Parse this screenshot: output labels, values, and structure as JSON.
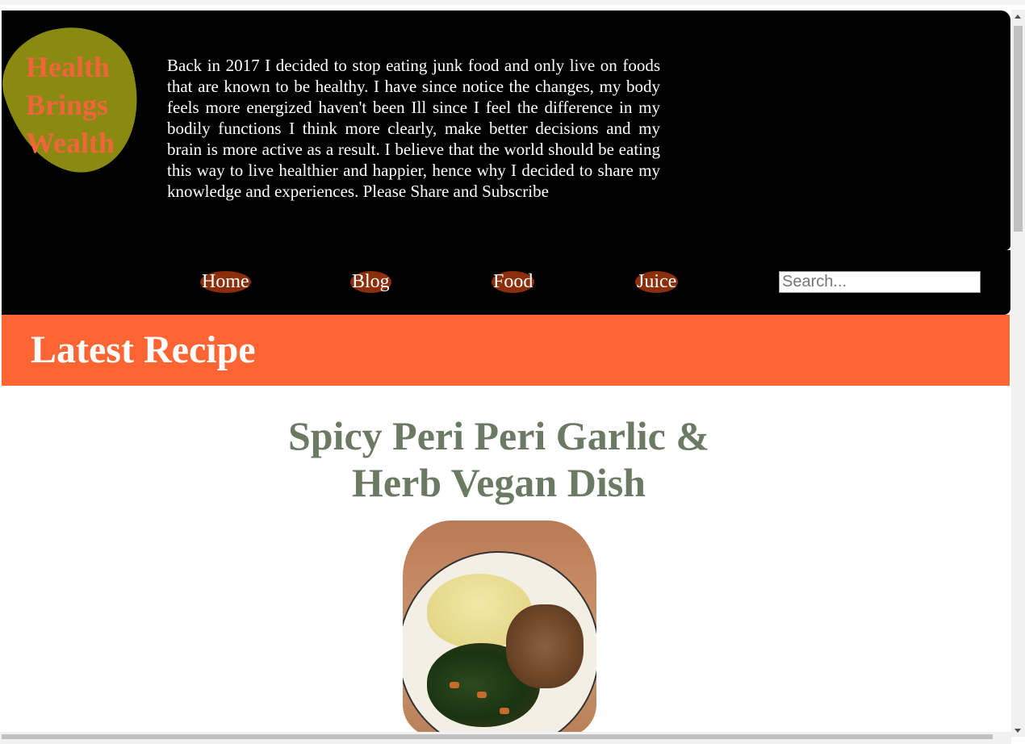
{
  "header": {
    "logo_text": "Health Brings Wealth",
    "intro": "Back in 2017 I decided to stop eating junk food and only live on foods that are known to be healthy. I have since notice the changes, my body feels more energized haven't been Ill since I feel the difference in my bodily functions I think more clearly, make better decisions and my brain is more active as a result. I believe that the world should be eating this way to live healthier and happier, hence why I decided to share my knowledge and experiences. Please Share and Subscribe"
  },
  "nav": {
    "items": [
      {
        "label": "Home"
      },
      {
        "label": "Blog"
      },
      {
        "label": "Food"
      },
      {
        "label": "Juice"
      }
    ],
    "search_placeholder": "Search..."
  },
  "banner": {
    "title": "Latest Recipe"
  },
  "recipe": {
    "title": "Spicy Peri Peri Garlic & Herb Vegan Dish"
  },
  "colors": {
    "header_bg": "#000000",
    "logo_bg": "#8a8a12",
    "logo_text": "#f0663a",
    "nav_pill": "#8b2e0c",
    "banner_bg": "#ff6533",
    "recipe_title": "#6b7a63"
  }
}
